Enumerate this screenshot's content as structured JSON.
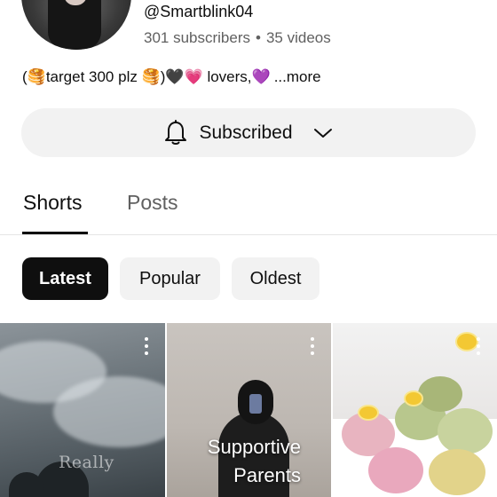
{
  "channel": {
    "handle": "@Smartblink04",
    "subscribers": "301 subscribers",
    "separator": "•",
    "videos": "35 videos",
    "bio": "(🥞target 300 plz 🥞)🖤💗 lovers,💜",
    "more_label": "...more"
  },
  "subscribe_button": {
    "label": "Subscribed",
    "icon": "bell-icon",
    "chevron": "chevron-down-icon"
  },
  "tabs": [
    {
      "label": "Shorts",
      "active": true
    },
    {
      "label": "Posts",
      "active": false
    }
  ],
  "filters": [
    {
      "label": "Latest",
      "selected": true
    },
    {
      "label": "Popular",
      "selected": false
    },
    {
      "label": "Oldest",
      "selected": false
    }
  ],
  "shorts": [
    {
      "caption": "Really",
      "menu_icon": "more-vert-icon"
    },
    {
      "caption_line1": "Supportive",
      "caption_line2": "Parents",
      "menu_icon": "more-vert-icon"
    },
    {
      "caption": "",
      "menu_icon": "more-vert-icon"
    }
  ],
  "colors": {
    "text_primary": "#0f0f0f",
    "text_secondary": "#606060",
    "chip_bg": "#f2f2f2",
    "chip_selected_bg": "#0f0f0f"
  }
}
